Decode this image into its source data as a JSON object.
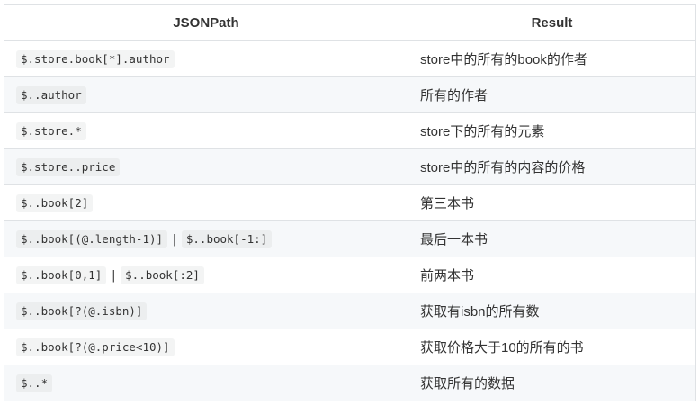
{
  "table": {
    "headers": [
      "JSONPath",
      "Result"
    ],
    "rows": [
      {
        "expr": [
          "$.store.book[*].author"
        ],
        "result": "store中的所有的book的作者"
      },
      {
        "expr": [
          "$..author"
        ],
        "result": "所有的作者"
      },
      {
        "expr": [
          "$.store.*"
        ],
        "result": "store下的所有的元素"
      },
      {
        "expr": [
          "$.store..price"
        ],
        "result": "store中的所有的内容的价格"
      },
      {
        "expr": [
          "$..book[2]"
        ],
        "result": "第三本书"
      },
      {
        "expr": [
          "$..book[(@.length-1)]",
          "$..book[-1:]"
        ],
        "result": "最后一本书"
      },
      {
        "expr": [
          "$..book[0,1]",
          "$..book[:2]"
        ],
        "result": "前两本书"
      },
      {
        "expr": [
          "$..book[?(@.isbn)]"
        ],
        "result": "获取有isbn的所有数"
      },
      {
        "expr": [
          "$..book[?(@.price<10)]"
        ],
        "result": "获取价格大于10的所有的书"
      },
      {
        "expr": [
          "$..*"
        ],
        "result": "获取所有的数据"
      }
    ],
    "separator": "|"
  }
}
